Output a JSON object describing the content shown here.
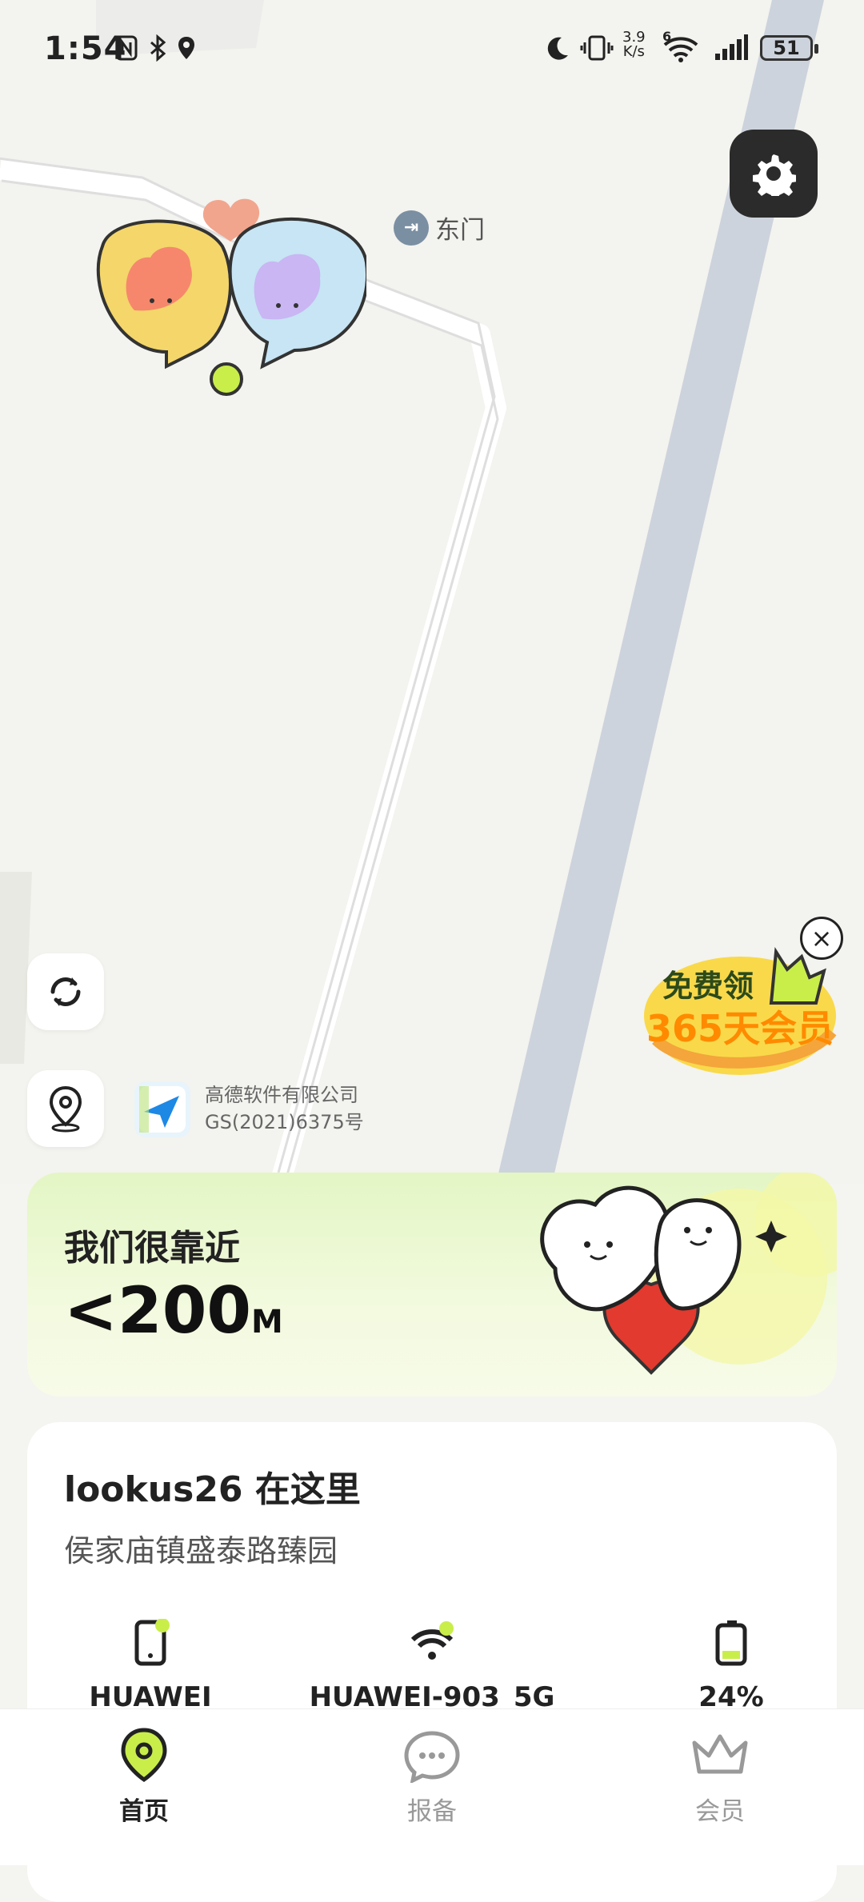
{
  "status_bar": {
    "time": "1:54",
    "net_speed_value": "3.9",
    "net_speed_unit": "K/s",
    "wifi_badge": "6",
    "battery_level": "51"
  },
  "map": {
    "poi_label": "东门",
    "provider_name": "高德软件有限公司",
    "provider_license": "GS(2021)6375号",
    "promo_line1": "免费领",
    "promo_line2": "365天会员"
  },
  "proximity": {
    "title": "我们很靠近",
    "distance": "<200",
    "unit": "M"
  },
  "location_card": {
    "title": "lookus26 在这里",
    "address": "侯家庙镇盛泰路臻园",
    "devices": [
      {
        "icon": "phone-icon",
        "value": "HUAWEI"
      },
      {
        "icon": "wifi-icon",
        "value": "HUAWEI-903_5G"
      },
      {
        "icon": "battery-icon",
        "value": "24%"
      }
    ]
  },
  "nav": {
    "items": [
      {
        "label": "首页",
        "icon": "location-pin-icon",
        "active": true
      },
      {
        "label": "报备",
        "icon": "chat-bubble-icon",
        "active": false
      },
      {
        "label": "会员",
        "icon": "crown-icon",
        "active": false
      }
    ]
  },
  "colors": {
    "accent_green": "#c9ee4a",
    "dark": "#2b2b2b",
    "road": "#cdd3dc"
  }
}
